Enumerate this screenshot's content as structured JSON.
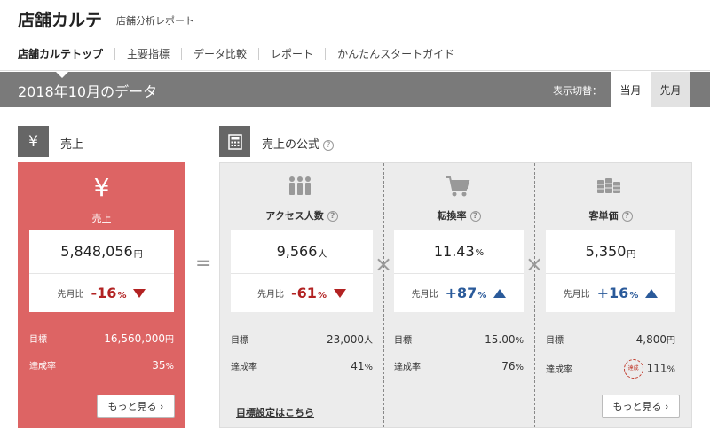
{
  "header": {
    "title": "店舗カルテ",
    "subtitle": "店舗分析レポート"
  },
  "nav": {
    "items": [
      "店舗カルテトップ",
      "主要指標",
      "データ比較",
      "レポート",
      "かんたんスタートガイド"
    ]
  },
  "databar": {
    "title": "2018年10月のデータ",
    "switch_label": "表示切替：",
    "current": "当月",
    "previous": "先月"
  },
  "sales": {
    "section_title": "売上",
    "icon": "yen-icon",
    "icon_glyph": "¥",
    "label": "売上",
    "value": "5,848,056",
    "unit": "円",
    "compare_label": "先月比",
    "compare_value": "-16",
    "compare_unit": "%",
    "target_label": "目標",
    "target_value": "16,560,000",
    "target_unit": "円",
    "rate_label": "達成率",
    "rate_value": "35",
    "rate_unit": "%",
    "more": "もっと見る ›"
  },
  "formula": {
    "section_title": "売上の公式",
    "equals": "=",
    "times": "×",
    "link": "目標設定はこちら",
    "more": "もっと見る ›",
    "badge": "達成",
    "columns": [
      {
        "icon": "people-icon",
        "label": "アクセス人数",
        "value": "9,566",
        "unit": "人",
        "compare_label": "先月比",
        "compare_value": "-61",
        "compare_unit": "%",
        "target_label": "目標",
        "target_value": "23,000",
        "target_unit": "人",
        "rate_label": "達成率",
        "rate_value": "41",
        "rate_unit": "%"
      },
      {
        "icon": "cart-icon",
        "label": "転換率",
        "value": "11.43",
        "unit": "%",
        "compare_label": "先月比",
        "compare_value": "+87",
        "compare_unit": "%",
        "target_label": "目標",
        "target_value": "15.00",
        "target_unit": "%",
        "rate_label": "達成率",
        "rate_value": "76",
        "rate_unit": "%"
      },
      {
        "icon": "coins-icon",
        "label": "客単価",
        "value": "5,350",
        "unit": "円",
        "compare_label": "先月比",
        "compare_value": "+16",
        "compare_unit": "%",
        "target_label": "目標",
        "target_value": "4,800",
        "target_unit": "円",
        "rate_label": "達成率",
        "rate_value": "111",
        "rate_unit": "%"
      }
    ]
  },
  "colors": {
    "sales_card": "#dd6464",
    "down": "#b22222",
    "up": "#2a5a9a",
    "bar": "#7a7a7a"
  }
}
